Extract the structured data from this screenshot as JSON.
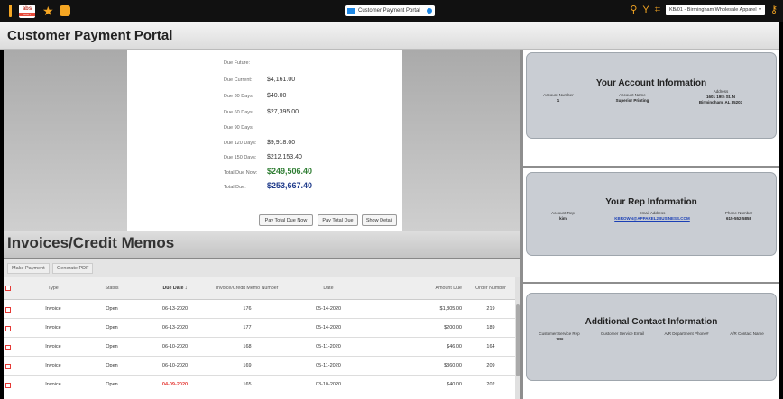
{
  "topbar": {
    "logo_top": "abs",
    "logo_bottom": "SHIFT",
    "portal_label": "Customer Payment Portal",
    "company": "KB/01 - Birmingham Wholesale Apparel",
    "colors": {
      "accent": "#f5a623",
      "portal_icon": "#1e88e5"
    }
  },
  "page": {
    "title": "Customer Payment Portal"
  },
  "summary": {
    "rows": [
      {
        "label": "Due Future:",
        "value": ""
      },
      {
        "label": "Due Current:",
        "value": "$4,161.00"
      },
      {
        "label": "Due 30 Days:",
        "value": "$40.00"
      },
      {
        "label": "Due 60 Days:",
        "value": "$27,395.00"
      },
      {
        "label": "Due 90 Days:",
        "value": ""
      },
      {
        "label": "Due 120 Days:",
        "value": "$9,918.00"
      },
      {
        "label": "Due 150 Days:",
        "value": "$212,153.40"
      },
      {
        "label": "Total Due Now:",
        "value": "$249,506.40"
      },
      {
        "label": "Total Due:",
        "value": "$253,667.40"
      }
    ],
    "buttons": {
      "pay_now": "Pay Total Due Now",
      "pay_total": "Pay Total Due",
      "show_detail": "Show Detail"
    }
  },
  "invoices": {
    "title": "Invoices/Credit Memos",
    "toolbar": {
      "make_payment": "Make Payment",
      "generate_pdf": "Generate PDF"
    },
    "columns": [
      "Type",
      "Status",
      "Due Date ↓",
      "Invoice/Credit Memo Number",
      "Date",
      "Amount Due",
      "Order Number"
    ],
    "rows": [
      [
        "Invoice",
        "Open",
        "06-13-2020",
        "176",
        "05-14-2020",
        "$1,805.00",
        "219"
      ],
      [
        "Invoice",
        "Open",
        "06-13-2020",
        "177",
        "05-14-2020",
        "$200.00",
        "189"
      ],
      [
        "Invoice",
        "Open",
        "06-10-2020",
        "168",
        "05-11-2020",
        "$46.00",
        "164"
      ],
      [
        "Invoice",
        "Open",
        "06-10-2020",
        "169",
        "05-11-2020",
        "$360.00",
        "209"
      ],
      [
        "Invoice",
        "Open",
        "04-09-2020",
        "165",
        "03-10-2020",
        "$40.00",
        "202"
      ]
    ],
    "overdue_color": "#e53935"
  },
  "account": {
    "title": "Your Account Information",
    "number_label": "Account Number",
    "number": "1",
    "name_label": "Account Name",
    "name": "Superior Printing",
    "address_label": "Address",
    "address1": "1601 19th St. N",
    "address2": "Birmingham, AL 35203"
  },
  "rep": {
    "title": "Your Rep Information",
    "rep_label": "Account Rep",
    "rep": "kim",
    "email_label": "Email Address",
    "email": "KBROWN@APPAREL2BUSINESS.COM",
    "phone_label": "Phone Number",
    "phone": "615-552-5858"
  },
  "contact": {
    "title": "Additional Contact Information",
    "cols": [
      {
        "label": "Customer Service Rep",
        "value": "JEN"
      },
      {
        "label": "Customer Service Email",
        "value": ""
      },
      {
        "label": "A/R Department Phone#",
        "value": ""
      },
      {
        "label": "A/R Contact Name",
        "value": ""
      }
    ]
  }
}
